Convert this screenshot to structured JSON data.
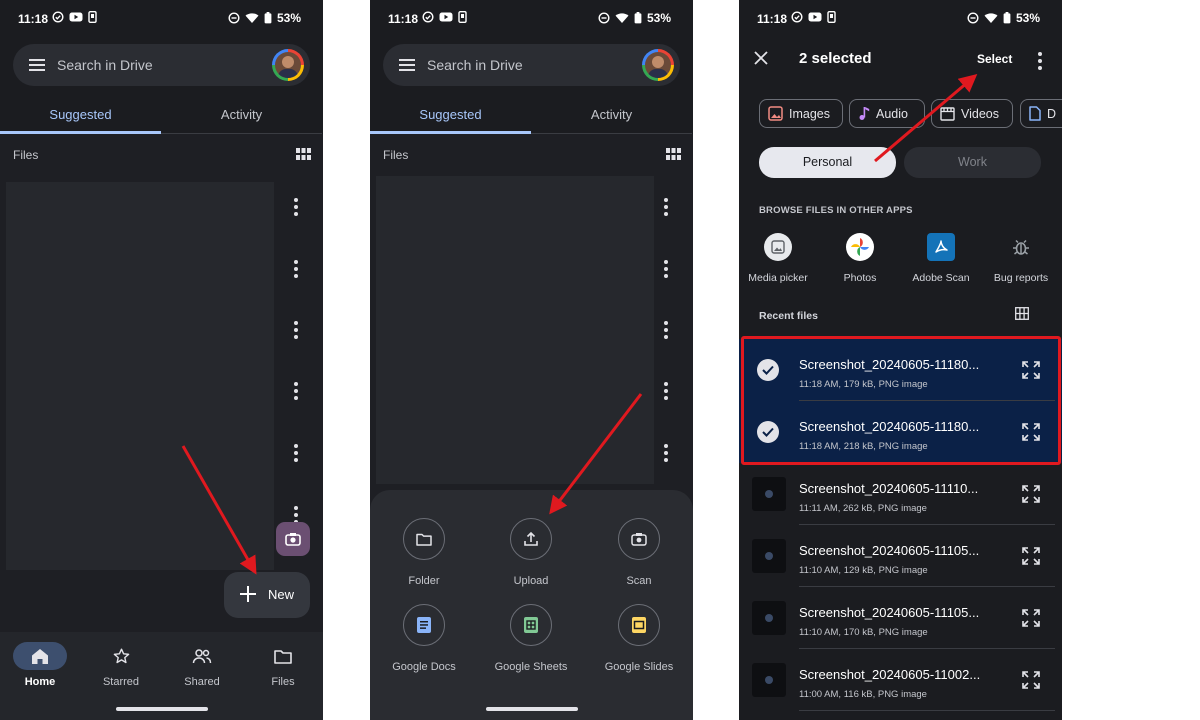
{
  "status": {
    "time": "11:18",
    "battery": "53%"
  },
  "drive": {
    "search_placeholder": "Search in Drive",
    "tabs": [
      "Suggested",
      "Activity"
    ],
    "files_label": "Files",
    "nav": [
      "Home",
      "Starred",
      "Shared",
      "Files"
    ],
    "new_label": "New"
  },
  "create_sheet": {
    "items": [
      "Folder",
      "Upload",
      "Scan",
      "Google Docs",
      "Google Sheets",
      "Google Slides"
    ]
  },
  "picker": {
    "title": "2 selected",
    "select_label": "Select",
    "chips": [
      "Images",
      "Audio",
      "Videos",
      "D"
    ],
    "segments": [
      "Personal",
      "Work"
    ],
    "browse_label": "BROWSE FILES IN OTHER APPS",
    "apps": [
      "Media picker",
      "Photos",
      "Adobe Scan",
      "Bug reports"
    ],
    "recent_label": "Recent files",
    "files": [
      {
        "name": "Screenshot_20240605-11180...",
        "meta": "11:18 AM, 179 kB, PNG image",
        "selected": true
      },
      {
        "name": "Screenshot_20240605-11180...",
        "meta": "11:18 AM, 218 kB, PNG image",
        "selected": true
      },
      {
        "name": "Screenshot_20240605-11110...",
        "meta": "11:11 AM, 262 kB, PNG image",
        "selected": false
      },
      {
        "name": "Screenshot_20240605-11105...",
        "meta": "11:10 AM, 129 kB, PNG image",
        "selected": false
      },
      {
        "name": "Screenshot_20240605-11105...",
        "meta": "11:10 AM, 170 kB, PNG image",
        "selected": false
      },
      {
        "name": "Screenshot_20240605-11002...",
        "meta": "11:00 AM, 116 kB, PNG image",
        "selected": false
      }
    ]
  },
  "colors": {
    "phone_bg": "#1b1c20",
    "tab_active": "#a8c7fa",
    "selection_bg": "#0b2147",
    "annotation_red": "#e0191f"
  }
}
